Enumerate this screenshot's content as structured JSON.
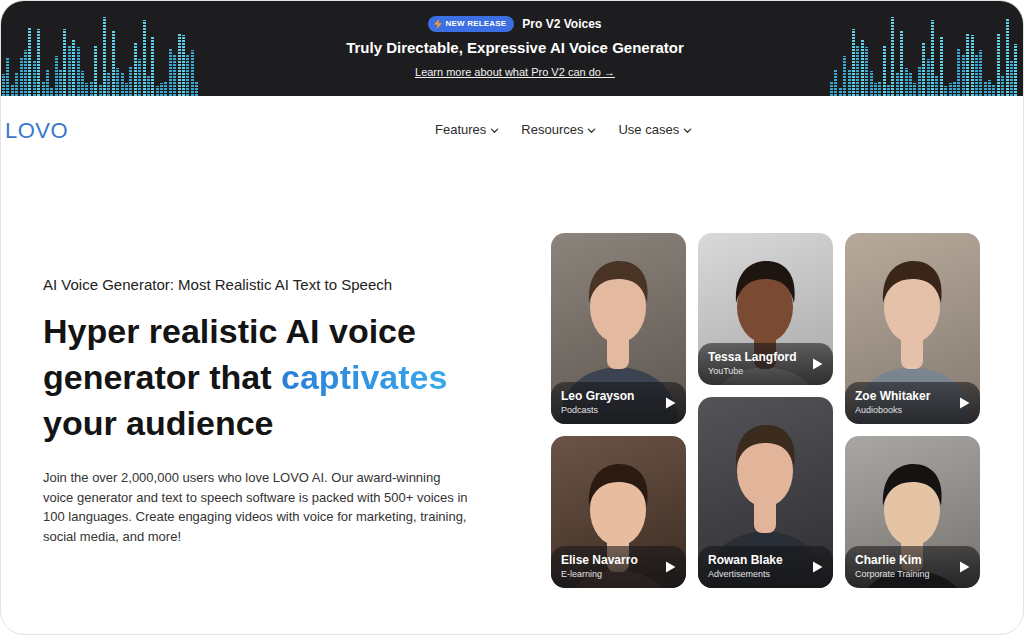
{
  "banner": {
    "badge": "NEW RELEASE",
    "product": "Pro V2 Voices",
    "headline": "Truly Directable, Expressive AI Voice Generator",
    "link": "Learn more about what Pro V2 can do →"
  },
  "nav": {
    "logo": "LOVO",
    "items": [
      {
        "label": "Features",
        "expanded": false
      },
      {
        "label": "Resources",
        "expanded": false
      },
      {
        "label": "Use cases",
        "expanded": false
      }
    ]
  },
  "hero": {
    "eyebrow": "AI Voice Generator: Most Realistic AI Text to Speech",
    "headline": [
      {
        "text": "Hyper realistic AI voice generator that ",
        "highlight": false
      },
      {
        "text": "captivates",
        "highlight": true
      },
      {
        "text": " your audience",
        "highlight": false
      }
    ],
    "description": "Join the over 2,000,000 users who love LOVO AI. Our award-winning voice generator and text to speech software is packed with 500+ voices in 100 languages. Create engaging videos with voice for marketing, training, social media, and more!"
  },
  "voices": [
    {
      "name": "Leo Grayson",
      "use_case": "Podcasts"
    },
    {
      "name": "Tessa Langford",
      "use_case": "YouTube"
    },
    {
      "name": "Zoe Whitaker",
      "use_case": "Audiobooks"
    },
    {
      "name": "Elise Navarro",
      "use_case": "E-learning"
    },
    {
      "name": "Rowan Blake",
      "use_case": "Advertisements"
    },
    {
      "name": "Charlie Kim",
      "use_case": "Corporate Training"
    }
  ]
}
